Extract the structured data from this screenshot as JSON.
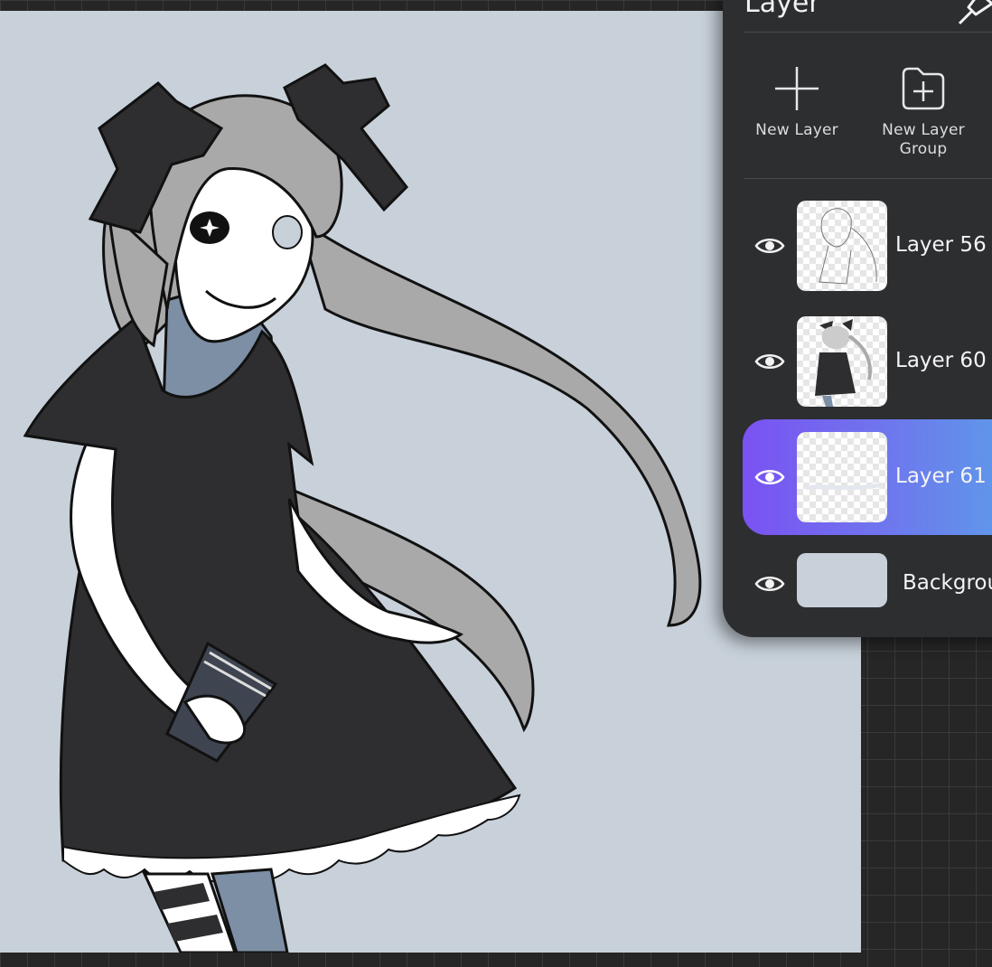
{
  "panel": {
    "title": "Layer",
    "actions": {
      "new_layer": "New Layer",
      "new_group_line1": "New Layer",
      "new_group_line2": "Group"
    },
    "layers": [
      {
        "name": "Layer 56",
        "visible": true,
        "selected": false
      },
      {
        "name": "Layer 60",
        "visible": true,
        "selected": false
      },
      {
        "name": "Layer 61",
        "visible": true,
        "selected": true
      },
      {
        "name": "Background",
        "visible": true,
        "selected": false
      }
    ]
  },
  "colors": {
    "canvas_background": "#c8d1da",
    "panel_background": "#2d2e30",
    "selection_gradient_start": "#7a52f2",
    "selection_gradient_end": "#5aa3e8"
  },
  "icons": [
    "pin-icon",
    "plus-icon",
    "folder-plus-icon",
    "eye-icon"
  ]
}
